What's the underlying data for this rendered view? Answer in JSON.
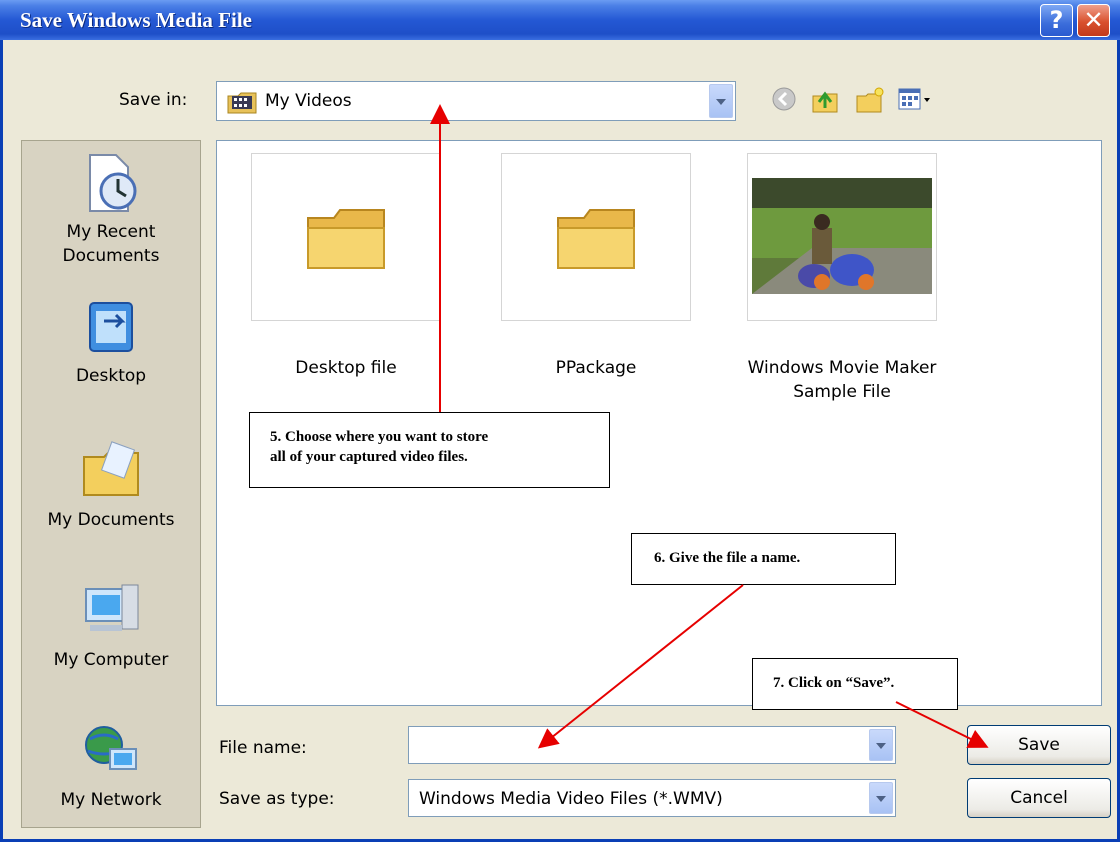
{
  "window": {
    "title": "Save Windows Media File",
    "help_label": "?",
    "close_label": "✕"
  },
  "toolbar": {
    "save_in_label": "Save in:",
    "save_in_value": "My Videos",
    "icons": [
      "back-icon",
      "up-folder-icon",
      "new-folder-icon",
      "view-menu-icon"
    ]
  },
  "places": [
    {
      "label": "My Recent\nDocuments",
      "icon": "recent-documents-icon"
    },
    {
      "label": "Desktop",
      "icon": "desktop-icon"
    },
    {
      "label": "My Documents",
      "icon": "my-documents-icon"
    },
    {
      "label": "My Computer",
      "icon": "my-computer-icon"
    },
    {
      "label": "My Network",
      "icon": "my-network-icon"
    }
  ],
  "files": [
    {
      "label": "Desktop file",
      "type": "folder"
    },
    {
      "label": "PPackage",
      "type": "folder"
    },
    {
      "label": "Windows Movie Maker\nSample File",
      "type": "video"
    }
  ],
  "form": {
    "file_name_label": "File name:",
    "file_name_value": "",
    "save_as_type_label": "Save as type:",
    "save_as_type_value": "Windows Media Video Files (*.WMV)"
  },
  "buttons": {
    "save": "Save",
    "cancel": "Cancel"
  },
  "callouts": {
    "step5": "5.  Choose where you want to store\nall of your captured video files.",
    "step6": "6.  Give the file a name.",
    "step7": "7.  Click on “Save”."
  },
  "colors": {
    "title_bar": "#2458d4",
    "annotation_arrow": "#e60000",
    "folder": "#f6d56f"
  }
}
